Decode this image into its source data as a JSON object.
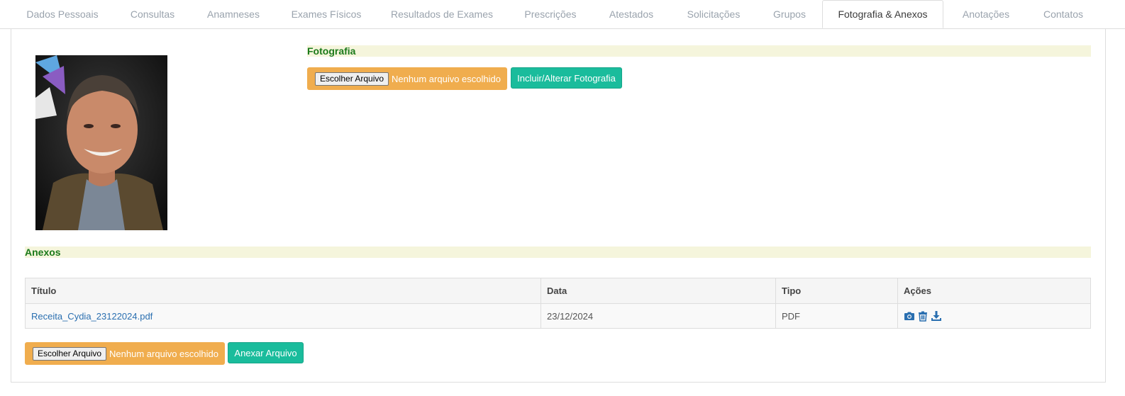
{
  "tabs": [
    {
      "label": "Dados Pessoais"
    },
    {
      "label": "Consultas"
    },
    {
      "label": "Anamneses"
    },
    {
      "label": "Exames Físicos"
    },
    {
      "label": "Resultados de Exames"
    },
    {
      "label": "Prescrições"
    },
    {
      "label": "Atestados"
    },
    {
      "label": "Solicitações"
    },
    {
      "label": "Grupos"
    },
    {
      "label": "Fotografia & Anexos"
    },
    {
      "label": "Anotações"
    },
    {
      "label": "Contatos"
    }
  ],
  "active_tab": "Fotografia & Anexos",
  "photo_section": {
    "title": "Fotografia",
    "file_button": "Escolher Arquivo",
    "file_status": "Nenhum arquivo escolhido",
    "submit_label": "Incluir/Alterar Fotografia"
  },
  "attachments": {
    "title": "Anexos",
    "columns": [
      "Título",
      "Data",
      "Tipo",
      "Ações"
    ],
    "rows": [
      {
        "title": "Receita_Cydia_23122024.pdf",
        "date": "23/12/2024",
        "type": "PDF",
        "actions": [
          "camera-icon",
          "trash-icon",
          "download-icon"
        ]
      }
    ],
    "file_button": "Escolher Arquivo",
    "file_status": "Nenhum arquivo escolhido",
    "submit_label": "Anexar Arquivo"
  },
  "colors": {
    "accent_orange": "#f0ad4e",
    "accent_teal": "#1abc9c",
    "section_green": "#1b7a1b",
    "link_blue": "#2a6fb0"
  }
}
